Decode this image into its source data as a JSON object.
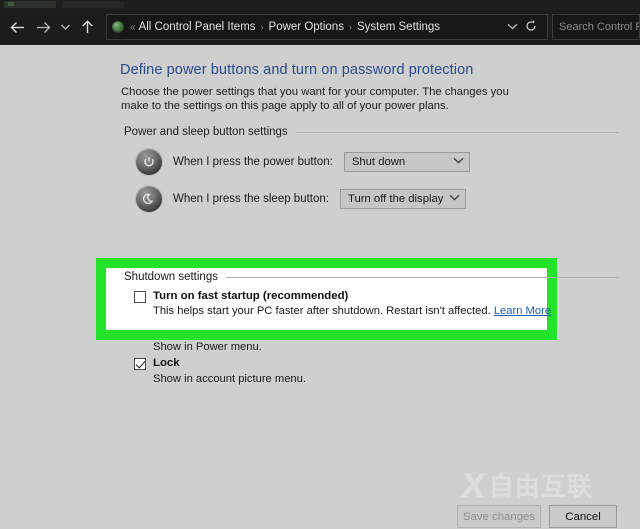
{
  "window": {
    "title": "System Settings"
  },
  "navbar": {
    "back_icon": "back-arrow-icon",
    "forward_icon": "forward-arrow-icon",
    "recent_icon": "chevron-down-icon",
    "up_icon": "up-arrow-icon",
    "address_icon": "control-panel-icon",
    "overflow": "«",
    "breadcrumbs": [
      "All Control Panel Items",
      "Power Options",
      "System Settings"
    ],
    "separator": "›",
    "dropdown_icon": "chevron-down-icon",
    "refresh_icon": "refresh-icon",
    "search": {
      "placeholder": "Search Control P",
      "value": ""
    }
  },
  "page": {
    "title": "Define power buttons and turn on password protection",
    "description": "Choose the power settings that you want for your computer. The changes you make to the settings on this page apply to all of your power plans."
  },
  "sections": {
    "power_sleep": {
      "label": "Power and sleep button settings",
      "rows": [
        {
          "icon": "power-button-icon",
          "label": "When I press the power button:",
          "value": "Shut down"
        },
        {
          "icon": "sleep-moon-icon",
          "label": "When I press the sleep button:",
          "value": "Turn off the display"
        }
      ]
    },
    "shutdown": {
      "label": "Shutdown settings",
      "fast_startup": {
        "checked": false,
        "title": "Turn on fast startup (recommended)",
        "description": "This helps start your PC faster after shutdown. Restart isn't affected.",
        "link": "Learn More"
      },
      "sleep_item": {
        "description": "Show in Power menu."
      },
      "lock_item": {
        "checked": true,
        "title": "Lock",
        "description": "Show in account picture menu."
      }
    }
  },
  "footer": {
    "save_label": "Save changes",
    "save_enabled": false,
    "cancel_label": "Cancel"
  },
  "watermark": {
    "mark": "X",
    "text": "自由互联"
  },
  "annotation": {
    "highlight_color": "#22e22a",
    "target": "Shutdown settings — Turn on fast startup (recommended)"
  },
  "colors": {
    "accent_title": "#2a4b8d",
    "link": "#1a5fb4",
    "chrome_dark": "#1b1c1b",
    "pane": "#cfcfcf",
    "highlight": "#22e22a"
  }
}
